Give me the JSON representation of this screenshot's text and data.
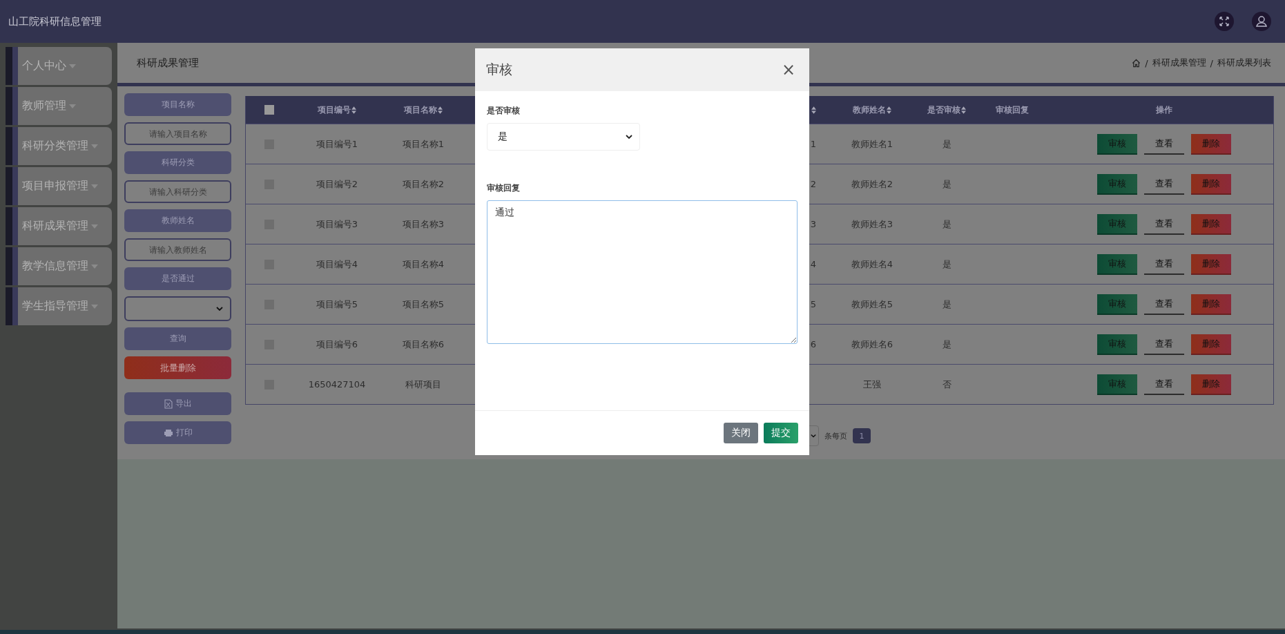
{
  "topbar": {
    "title": "山工院科研信息管理"
  },
  "sidebar": {
    "items": [
      {
        "label": "个人中心",
        "expanded": false
      },
      {
        "label": "教师管理",
        "expanded": false
      },
      {
        "label": "科研分类管理",
        "expanded": false
      },
      {
        "label": "项目申报管理",
        "expanded": false
      },
      {
        "label": "科研成果管理",
        "expanded": false
      },
      {
        "label": "教学信息管理",
        "expanded": false
      },
      {
        "label": "学生指导管理",
        "expanded": false
      }
    ]
  },
  "page_header": {
    "title": "科研成果管理",
    "breadcrumb": [
      "科研成果管理",
      "科研成果列表"
    ],
    "separator": "/"
  },
  "filters": [
    {
      "kind": "label",
      "text": "项目名称"
    },
    {
      "kind": "input",
      "placeholder": "请输入项目名称"
    },
    {
      "kind": "label",
      "text": "科研分类"
    },
    {
      "kind": "input",
      "placeholder": "请输入科研分类"
    },
    {
      "kind": "label",
      "text": "教师姓名"
    },
    {
      "kind": "input",
      "placeholder": "请输入教师姓名"
    },
    {
      "kind": "label",
      "text": "是否通过"
    },
    {
      "kind": "select"
    },
    {
      "kind": "query",
      "text": "查询"
    },
    {
      "kind": "delete",
      "text": "批量删除"
    },
    {
      "kind": "export",
      "text": "导出"
    },
    {
      "kind": "print",
      "text": "打印"
    }
  ],
  "table": {
    "select_all": {
      "checked": false
    },
    "columns": [
      {
        "label": "项目编号",
        "sortable": true
      },
      {
        "label": "项目名称",
        "sortable": true
      },
      {
        "sortable": true
      },
      {
        "label": "教师姓名",
        "sortable": true
      },
      {
        "label": "是否审核",
        "sortable": true
      },
      {
        "label": "审核回复",
        "sortable": false
      },
      {
        "label": "操作",
        "sortable": false
      }
    ],
    "rows": [
      {
        "checked": false,
        "cells": [
          "项目编号1",
          "项目名称1",
          "1",
          "教师姓名1",
          "是",
          ""
        ],
        "actions": [
          {
            "kind": "review",
            "label": "审核"
          },
          {
            "kind": "view",
            "label": "查看"
          },
          {
            "kind": "delete",
            "label": "删除"
          }
        ]
      },
      {
        "checked": false,
        "cells": [
          "项目编号2",
          "项目名称2",
          "2",
          "教师姓名2",
          "是",
          ""
        ],
        "actions": [
          {
            "kind": "review",
            "label": "审核"
          },
          {
            "kind": "view",
            "label": "查看"
          },
          {
            "kind": "delete",
            "label": "删除"
          }
        ]
      },
      {
        "checked": false,
        "cells": [
          "项目编号3",
          "项目名称3",
          "3",
          "教师姓名3",
          "是",
          ""
        ],
        "actions": [
          {
            "kind": "review",
            "label": "审核"
          },
          {
            "kind": "view",
            "label": "查看"
          },
          {
            "kind": "delete",
            "label": "删除"
          }
        ]
      },
      {
        "checked": false,
        "cells": [
          "项目编号4",
          "项目名称4",
          "4",
          "教师姓名4",
          "是",
          ""
        ],
        "actions": [
          {
            "kind": "review",
            "label": "审核"
          },
          {
            "kind": "view",
            "label": "查看"
          },
          {
            "kind": "delete",
            "label": "删除"
          }
        ]
      },
      {
        "checked": false,
        "cells": [
          "项目编号5",
          "项目名称5",
          "5",
          "教师姓名5",
          "是",
          ""
        ],
        "actions": [
          {
            "kind": "review",
            "label": "审核"
          },
          {
            "kind": "view",
            "label": "查看"
          },
          {
            "kind": "delete",
            "label": "删除"
          }
        ]
      },
      {
        "checked": false,
        "cells": [
          "项目编号6",
          "项目名称6",
          "6",
          "教师姓名6",
          "是",
          ""
        ],
        "actions": [
          {
            "kind": "review",
            "label": "审核"
          },
          {
            "kind": "view",
            "label": "查看"
          },
          {
            "kind": "delete",
            "label": "删除"
          }
        ]
      },
      {
        "checked": false,
        "cells": [
          "1650427104",
          "科研项目",
          "",
          "王强",
          "否",
          ""
        ],
        "actions": [
          {
            "kind": "review",
            "label": "审核"
          },
          {
            "kind": "view",
            "label": "查看"
          },
          {
            "kind": "delete",
            "label": "删除"
          }
        ]
      }
    ]
  },
  "pagination": {
    "per_page_label": "条每页",
    "pages": [
      {
        "label": "1",
        "selected": true
      }
    ]
  },
  "modal": {
    "title": "审核",
    "close": "×",
    "fields": [
      {
        "kind": "select",
        "label": "是否审核",
        "value": "是"
      },
      {
        "kind": "textarea",
        "label": "审核回复",
        "value": "通过"
      }
    ],
    "buttons": [
      {
        "kind": "close",
        "label": "关闭"
      },
      {
        "kind": "submit",
        "label": "提交"
      }
    ]
  }
}
